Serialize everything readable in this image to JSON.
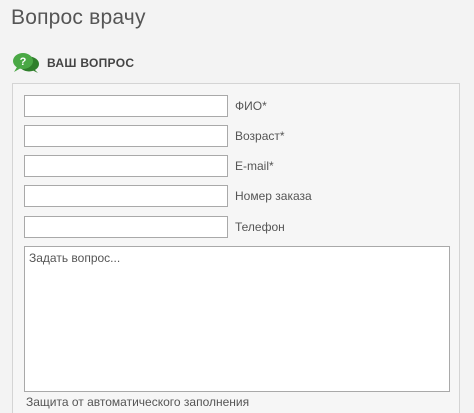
{
  "page": {
    "title": "Вопрос врачу"
  },
  "section": {
    "title": "ВАШ ВОПРОС",
    "icon": "chat-question-icon",
    "icon_color": "#3e9a3a"
  },
  "form": {
    "fields": [
      {
        "label": "ФИО*",
        "value": ""
      },
      {
        "label": "Возраст*",
        "value": ""
      },
      {
        "label": "E-mail*",
        "value": ""
      },
      {
        "label": "Номер заказа",
        "value": ""
      },
      {
        "label": "Телефон",
        "value": ""
      }
    ],
    "question": {
      "placeholder": "Задать вопрос...",
      "value": ""
    },
    "captcha_label": "Защита от автоматического заполнения"
  }
}
